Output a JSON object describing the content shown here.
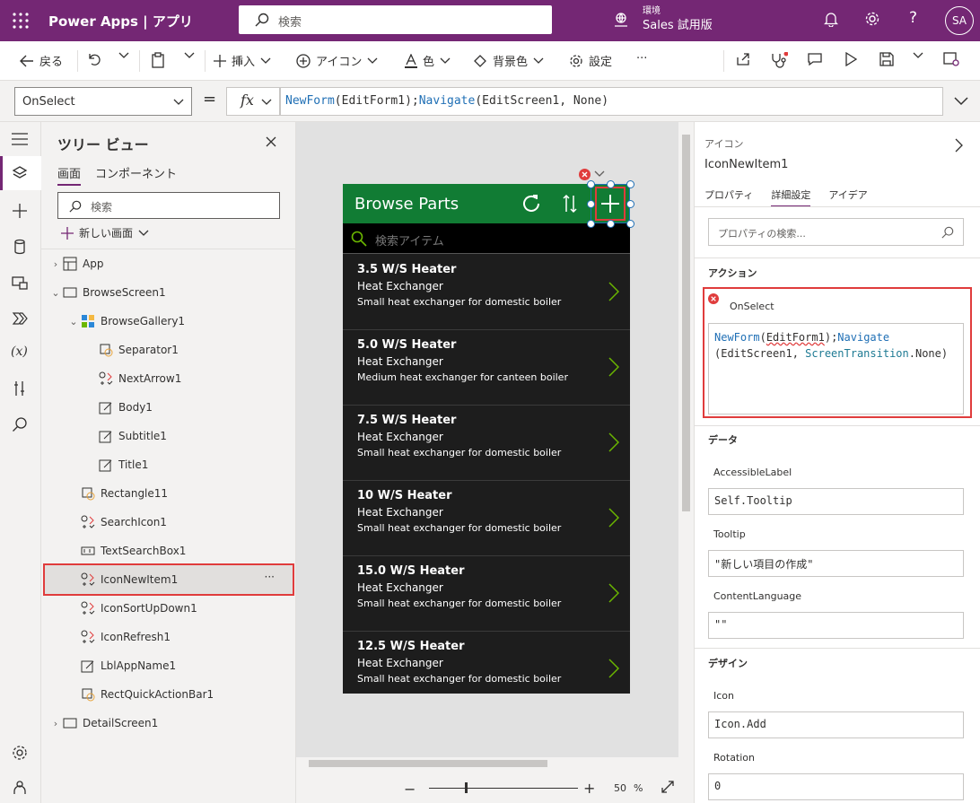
{
  "topbar": {
    "brand": "Power Apps  |  アプリ",
    "search_placeholder": "検索",
    "env_label": "環境",
    "env_value": "Sales 試用版",
    "avatar": "SA",
    "bg": "#742774"
  },
  "cmdbar": {
    "back": "戻る",
    "insert": "挿入",
    "icon": "アイコン",
    "color": "色",
    "bgcolor": "背景色",
    "settings": "設定",
    "more": "···"
  },
  "formula": {
    "property": "OnSelect",
    "equals": "=",
    "fx": "fx",
    "expr_fn1": "NewForm",
    "expr_arg1": "(EditForm1);",
    "expr_fn2": "Navigate",
    "expr_arg2": "(EditScreen1, None)"
  },
  "tree": {
    "title": "ツリー ビュー",
    "tab_screens": "画面",
    "tab_components": "コンポーネント",
    "search_placeholder": "検索",
    "new_screen": "新しい画面",
    "nodes": [
      {
        "label": "App"
      },
      {
        "label": "BrowseScreen1"
      },
      {
        "label": "BrowseGallery1"
      },
      {
        "label": "Separator1"
      },
      {
        "label": "NextArrow1"
      },
      {
        "label": "Body1"
      },
      {
        "label": "Subtitle1"
      },
      {
        "label": "Title1"
      },
      {
        "label": "Rectangle11"
      },
      {
        "label": "SearchIcon1"
      },
      {
        "label": "TextSearchBox1"
      },
      {
        "label": "IconNewItem1"
      },
      {
        "label": "IconSortUpDown1"
      },
      {
        "label": "IconRefresh1"
      },
      {
        "label": "LblAppName1"
      },
      {
        "label": "RectQuickActionBar1"
      },
      {
        "label": "DetailScreen1"
      }
    ]
  },
  "phone": {
    "title": "Browse Parts",
    "search_placeholder": "検索アイテム",
    "header_color": "#117c34",
    "items": [
      {
        "title": "3.5 W/S Heater",
        "subtitle": "Heat Exchanger",
        "body": "Small heat exchanger for domestic boiler"
      },
      {
        "title": "5.0 W/S Heater",
        "subtitle": "Heat Exchanger",
        "body": "Medium heat exchanger for canteen boiler"
      },
      {
        "title": "7.5 W/S Heater",
        "subtitle": "Heat Exchanger",
        "body": "Small heat exchanger for domestic boiler"
      },
      {
        "title": "10 W/S Heater",
        "subtitle": "Heat Exchanger",
        "body": "Small heat exchanger for domestic boiler"
      },
      {
        "title": "15.0 W/S Heater",
        "subtitle": "Heat Exchanger",
        "body": "Small heat exchanger for domestic boiler"
      },
      {
        "title": "12.5 W/S Heater",
        "subtitle": "Heat Exchanger",
        "body": "Small heat exchanger for domestic boiler"
      }
    ]
  },
  "zoom": {
    "value": "50",
    "unit": "%"
  },
  "panel": {
    "type": "アイコン",
    "name": "IconNewItem1",
    "tab_props": "プロパティ",
    "tab_advanced": "詳細設定",
    "tab_ideas": "アイデア",
    "search_placeholder": "プロパティの検索...",
    "section_action": "アクション",
    "onselect_label": "OnSelect",
    "code_fn1": "NewForm",
    "code_arg1a": "(",
    "code_arg1b": "EditForm1",
    "code_arg1c": ");",
    "code_fn2": "Navigate",
    "code_line2a": "(EditScreen1, ",
    "code_line2b": "ScreenTransition",
    "code_line2c": ".None)",
    "section_data": "データ",
    "accessible_label": "AccessibleLabel",
    "accessible_value": "Self.Tooltip",
    "tooltip_label": "Tooltip",
    "tooltip_value": "\"新しい項目の作成\"",
    "content_lang_label": "ContentLanguage",
    "content_lang_value": "\"\"",
    "section_design": "デザイン",
    "icon_label": "Icon",
    "icon_value": "Icon.Add",
    "rotation_label": "Rotation",
    "rotation_value": "0"
  }
}
